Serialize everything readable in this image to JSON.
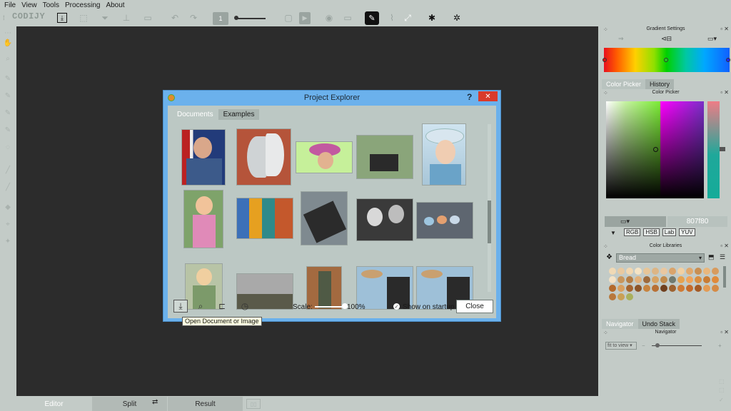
{
  "menu": [
    "File",
    "View",
    "Tools",
    "Processing",
    "About"
  ],
  "app": {
    "logo": "CODIJY"
  },
  "toolbar": {
    "brush_size": "1"
  },
  "canvas_bg": "#2c2c2c",
  "bottom_tabs": [
    "Editor",
    "Split",
    "Result"
  ],
  "dialog": {
    "title": "Project Explorer",
    "help": "?",
    "close_x": "✕",
    "tabs": [
      "Documents",
      "Examples"
    ],
    "scale_label": "Scale:",
    "scale_value": "100%",
    "show_on_startup": "Show on startup",
    "close_button": "Close",
    "tooltip": "Open Document or Image"
  },
  "right": {
    "gradient_title": "Gradient Settings",
    "color_tabs": [
      "Color Picker",
      "History"
    ],
    "color_picker_title": "Color Picker",
    "hex_value": "807f80",
    "color_modes": [
      "RGB",
      "HSB",
      "Lab",
      "YUV"
    ],
    "libraries_title": "Color Libraries",
    "library_name": "Bread",
    "nav_tabs": [
      "Navigator",
      "Undo Stack"
    ],
    "navigator_title": "Navigator",
    "fit_label": "fit to view"
  },
  "colors": {
    "accent": "#6bb1ec",
    "close_red": "#d93a2b",
    "bread_swatches": [
      "#f0d9b5",
      "#e8c9a0",
      "#f2d7b0",
      "#f5e3c4",
      "#e7c597",
      "#dcb585",
      "#e9c7a0",
      "#d9a46b",
      "#f1d0a3",
      "#e0a86c",
      "#c98f52",
      "#e9b77d",
      "#d79b5e",
      "#f4e2c6",
      "#c8965c",
      "#b57d45",
      "#e0b07a",
      "#9e6a3c",
      "#d7a364",
      "#c08a4b",
      "#707a6f",
      "#e6a24f",
      "#f0a35a",
      "#d88d40",
      "#c97c35",
      "#e08a3a",
      "#b46a2c",
      "#d9a060",
      "#a5642f",
      "#8c5428",
      "#c7843f",
      "#b87035",
      "#6f3f1e",
      "#9d6230",
      "#d07a34",
      "#c46a2b",
      "#a45a26",
      "#e39b54",
      "#d58a45",
      "#b8783c",
      "#c9a055",
      "#a9b05c"
    ]
  }
}
